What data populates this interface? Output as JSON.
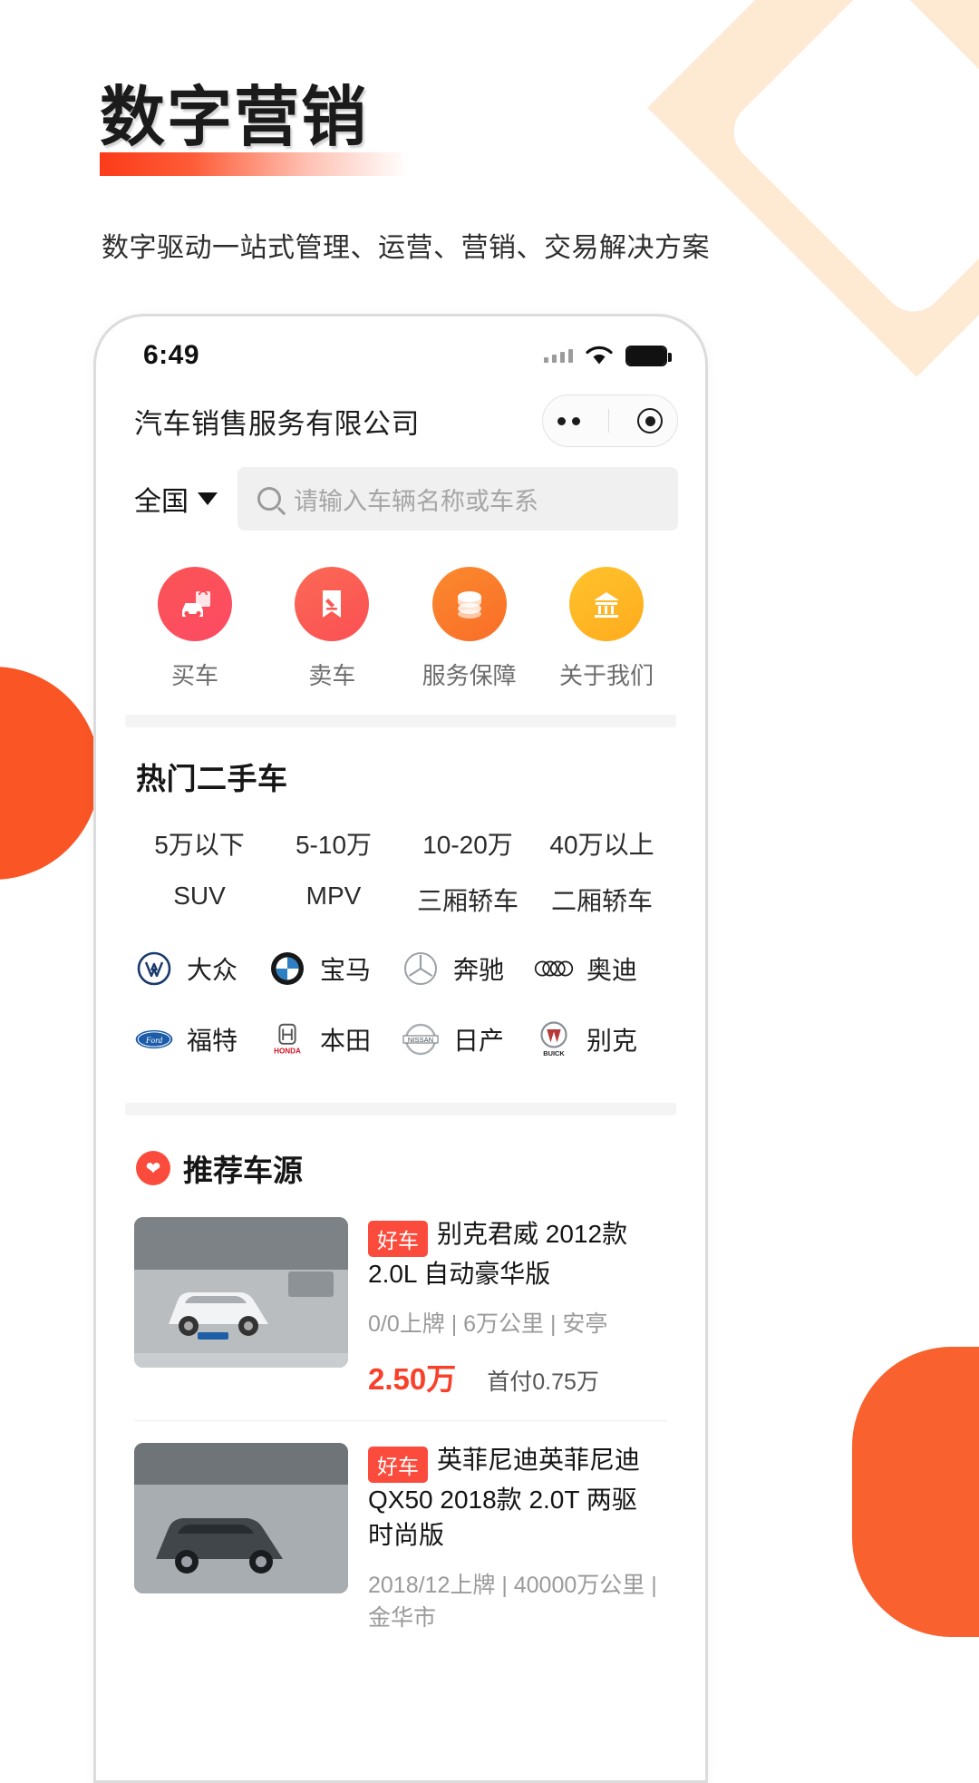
{
  "hero": {
    "title": "数字营销",
    "subtitle": "数字驱动一站式管理、运营、营销、交易解决方案",
    "accent_color": "#fc3b19"
  },
  "phone": {
    "status": {
      "time": "6:49",
      "signal_icon": "signal-bars-icon",
      "wifi_icon": "wifi-icon",
      "battery_icon": "battery-icon"
    },
    "header": {
      "title": "汽车销售服务有限公司",
      "menu_icon": "more-dots-icon",
      "target_icon": "target-icon"
    },
    "search": {
      "region": "全国",
      "region_caret_icon": "chevron-down-icon",
      "search_icon": "search-icon",
      "placeholder": "请输入车辆名称或车系"
    },
    "quicknav": [
      {
        "label": "买车",
        "icon": "car-shopping-icon",
        "color": "#fb4b55"
      },
      {
        "label": "卖车",
        "icon": "auction-gavel-icon",
        "color": "#fb5a54"
      },
      {
        "label": "服务保障",
        "icon": "coins-stack-icon",
        "color": "#f97a28"
      },
      {
        "label": "关于我们",
        "icon": "building-icon",
        "color": "#ffb824"
      }
    ],
    "hot_section": {
      "title": "热门二手车",
      "price_tags": [
        "5万以下",
        "5-10万",
        "10-20万",
        "40万以上"
      ],
      "type_tags": [
        "SUV",
        "MPV",
        "三厢轿车",
        "二厢轿车"
      ],
      "brands_row1": [
        {
          "name": "大众",
          "logo": "volkswagen-logo-icon"
        },
        {
          "name": "宝马",
          "logo": "bmw-logo-icon"
        },
        {
          "name": "奔驰",
          "logo": "mercedes-logo-icon"
        },
        {
          "name": "奥迪",
          "logo": "audi-logo-icon"
        }
      ],
      "brands_row2": [
        {
          "name": "福特",
          "logo": "ford-logo-icon"
        },
        {
          "name": "本田",
          "logo": "honda-logo-icon"
        },
        {
          "name": "日产",
          "logo": "nissan-logo-icon"
        },
        {
          "name": "别克",
          "logo": "buick-logo-icon"
        }
      ]
    },
    "recommend": {
      "title": "推荐车源",
      "heart_icon": "heart-icon",
      "cards": [
        {
          "badge": "好车",
          "name": "别克君威 2012款 2.0L 自动豪华版",
          "meta": "0/0上牌 | 6万公里 | 安亭",
          "price": "2.50万",
          "down_payment": "首付0.75万"
        },
        {
          "badge": "好车",
          "name": "英菲尼迪英菲尼迪QX50 2018款 2.0T 两驱 时尚版",
          "meta": "2018/12上牌 | 40000万公里 | 金华市",
          "price": "",
          "down_payment": ""
        }
      ]
    }
  }
}
